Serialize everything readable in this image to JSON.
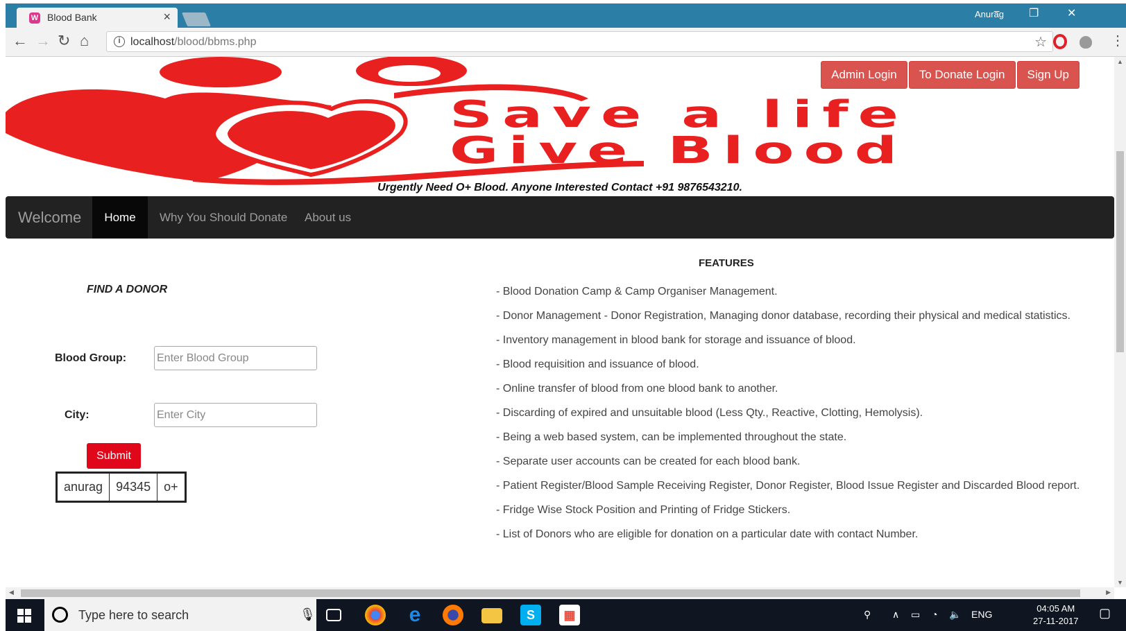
{
  "browser": {
    "tab_title": "Blood Bank",
    "tab_icon": "W",
    "tab_close": "×",
    "user": "Anurag",
    "minimize": "−",
    "restore": "❐",
    "close": "✕",
    "url_host": "localhost",
    "url_path": "/blood/bbms.php",
    "back_icon": "←",
    "forward_icon": "→",
    "reload_icon": "↻",
    "home_icon": "⌂",
    "info_icon": "i",
    "star_icon": "☆",
    "menu_icon": "⋮"
  },
  "banner": {
    "slogan_line1": "Save a life",
    "slogan_line2": "Give Blood",
    "notice": "Urgently Need O+ Blood. Anyone Interested Contact +91 9876543210.",
    "primary_color": "#e8201f"
  },
  "auth": {
    "admin_login": "Admin Login",
    "donor_login": "To Donate Login",
    "sign_up": "Sign Up",
    "button_color": "#d9534f"
  },
  "nav": {
    "brand": "Welcome",
    "items": [
      {
        "label": "Home",
        "active": true
      },
      {
        "label": "Why You Should Donate",
        "active": false
      },
      {
        "label": "About us",
        "active": false
      }
    ]
  },
  "find_donor": {
    "title": "FIND A DONOR",
    "blood_group_label": "Blood Group:",
    "blood_group_placeholder": "Enter Blood Group",
    "blood_group_value": "",
    "city_label": "City:",
    "city_placeholder": "Enter City",
    "city_value": "",
    "submit_label": "Submit",
    "submit_color": "#e0071a",
    "results": [
      {
        "name": "anurag",
        "contact": "94345",
        "blood_group": "o+"
      }
    ]
  },
  "features": {
    "title": "FEATURES",
    "items": [
      "- Blood Donation Camp & Camp Organiser Management.",
      "- Donor Management - Donor Registration, Managing donor database, recording their physical and medical statistics.",
      "- Inventory management in blood bank for storage and issuance of blood.",
      "- Blood requisition and issuance of blood.",
      "- Online transfer of blood from one blood bank to another.",
      "- Discarding of expired and unsuitable blood (Less Qty., Reactive, Clotting, Hemolysis).",
      "- Being a web based system, can be implemented throughout the state.",
      "- Separate user accounts can be created for each blood bank.",
      "- Patient Register/Blood Sample Receiving Register, Donor Register, Blood Issue Register and Discarded Blood report.",
      "- Fridge Wise Stock Position and Printing of Fridge Stickers.",
      "- List of Donors who are eligible for donation on a particular date with contact Number."
    ]
  },
  "taskbar": {
    "search_placeholder": "Type here to search",
    "lang": "ENG",
    "time": "04:05 AM",
    "date": "27-11-2017",
    "apps": [
      "task-view-icon",
      "chrome-icon",
      "edge-icon",
      "firefox-icon",
      "file-explorer-icon",
      "skype-icon",
      "store-icon"
    ]
  }
}
